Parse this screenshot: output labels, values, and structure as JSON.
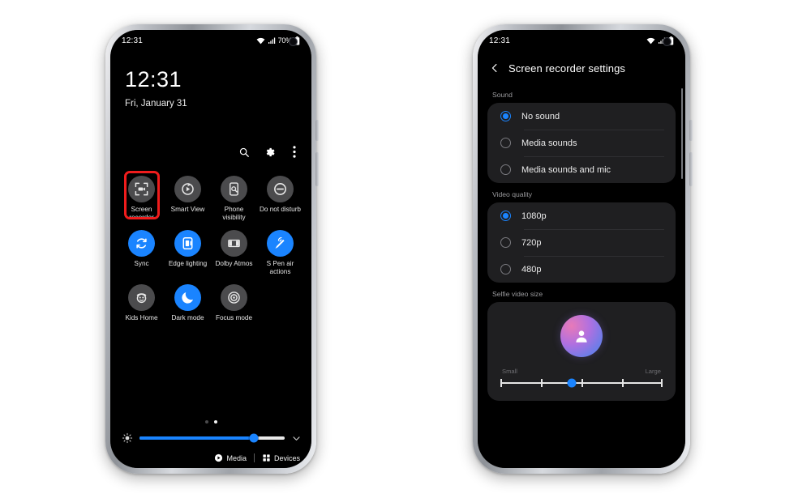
{
  "colors": {
    "accent": "#1a84ff",
    "highlight": "#ef1c1c",
    "tile_off": "#4b4b4d",
    "card": "#1f1f21",
    "screen_bg": "#000000"
  },
  "left_phone": {
    "status": {
      "time": "12:31",
      "wifi_icon": "wifi-icon",
      "signal_icon": "signal-icon",
      "battery_text": "70%",
      "battery_icon": "battery-icon"
    },
    "clock": "12:31",
    "date": "Fri, January 31",
    "actions": [
      {
        "name": "search-icon",
        "label": "Search"
      },
      {
        "name": "gear-icon",
        "label": "Settings"
      },
      {
        "name": "overflow-menu-icon",
        "label": "More options"
      }
    ],
    "tiles": [
      {
        "label": "Screen recorder",
        "icon": "screen-recorder-icon",
        "active": false,
        "highlighted": true
      },
      {
        "label": "Smart View",
        "icon": "smart-view-icon",
        "active": false,
        "highlighted": false
      },
      {
        "label": "Phone visibility",
        "icon": "phone-visibility-icon",
        "active": false,
        "highlighted": false
      },
      {
        "label": "Do not disturb",
        "icon": "do-not-disturb-icon",
        "active": false,
        "highlighted": false
      },
      {
        "label": "Sync",
        "icon": "sync-icon",
        "active": true,
        "highlighted": false
      },
      {
        "label": "Edge lighting",
        "icon": "edge-lighting-icon",
        "active": true,
        "highlighted": false
      },
      {
        "label": "Dolby Atmos",
        "icon": "dolby-atmos-icon",
        "active": false,
        "highlighted": false
      },
      {
        "label": "S Pen air actions",
        "icon": "s-pen-air-actions-icon",
        "active": true,
        "highlighted": false
      },
      {
        "label": "Kids Home",
        "icon": "kids-home-icon",
        "active": false,
        "highlighted": false
      },
      {
        "label": "Dark mode",
        "icon": "dark-mode-icon",
        "active": true,
        "highlighted": false
      },
      {
        "label": "Focus mode",
        "icon": "focus-mode-icon",
        "active": false,
        "highlighted": false
      }
    ],
    "page_indicator": {
      "total": 2,
      "active_index": 1
    },
    "brightness": {
      "icon": "brightness-icon",
      "value_percent": 79,
      "expand_icon": "chevron-down-icon"
    },
    "bottom_bar": {
      "media_label": "Media",
      "media_icon": "play-circle-icon",
      "devices_label": "Devices",
      "devices_icon": "devices-grid-icon"
    }
  },
  "right_phone": {
    "status": {
      "time": "12:31",
      "wifi_icon": "wifi-icon",
      "signal_icon": "signal-icon",
      "battery_icon": "battery-icon"
    },
    "appbar": {
      "back_icon": "back-chevron-icon",
      "title": "Screen recorder settings"
    },
    "sections": [
      {
        "heading": "Sound",
        "type": "radio-group",
        "options": [
          {
            "label": "No sound",
            "selected": true
          },
          {
            "label": "Media sounds",
            "selected": false
          },
          {
            "label": "Media sounds and mic",
            "selected": false
          }
        ]
      },
      {
        "heading": "Video quality",
        "type": "radio-group",
        "options": [
          {
            "label": "1080p",
            "selected": true
          },
          {
            "label": "720p",
            "selected": false
          },
          {
            "label": "480p",
            "selected": false
          }
        ]
      }
    ],
    "selfie": {
      "heading": "Selfie video size",
      "avatar_icon": "person-avatar-icon",
      "min_label": "Small",
      "max_label": "Large",
      "value_percent": 44,
      "tick_positions": [
        0,
        25,
        50,
        75,
        100
      ]
    }
  }
}
